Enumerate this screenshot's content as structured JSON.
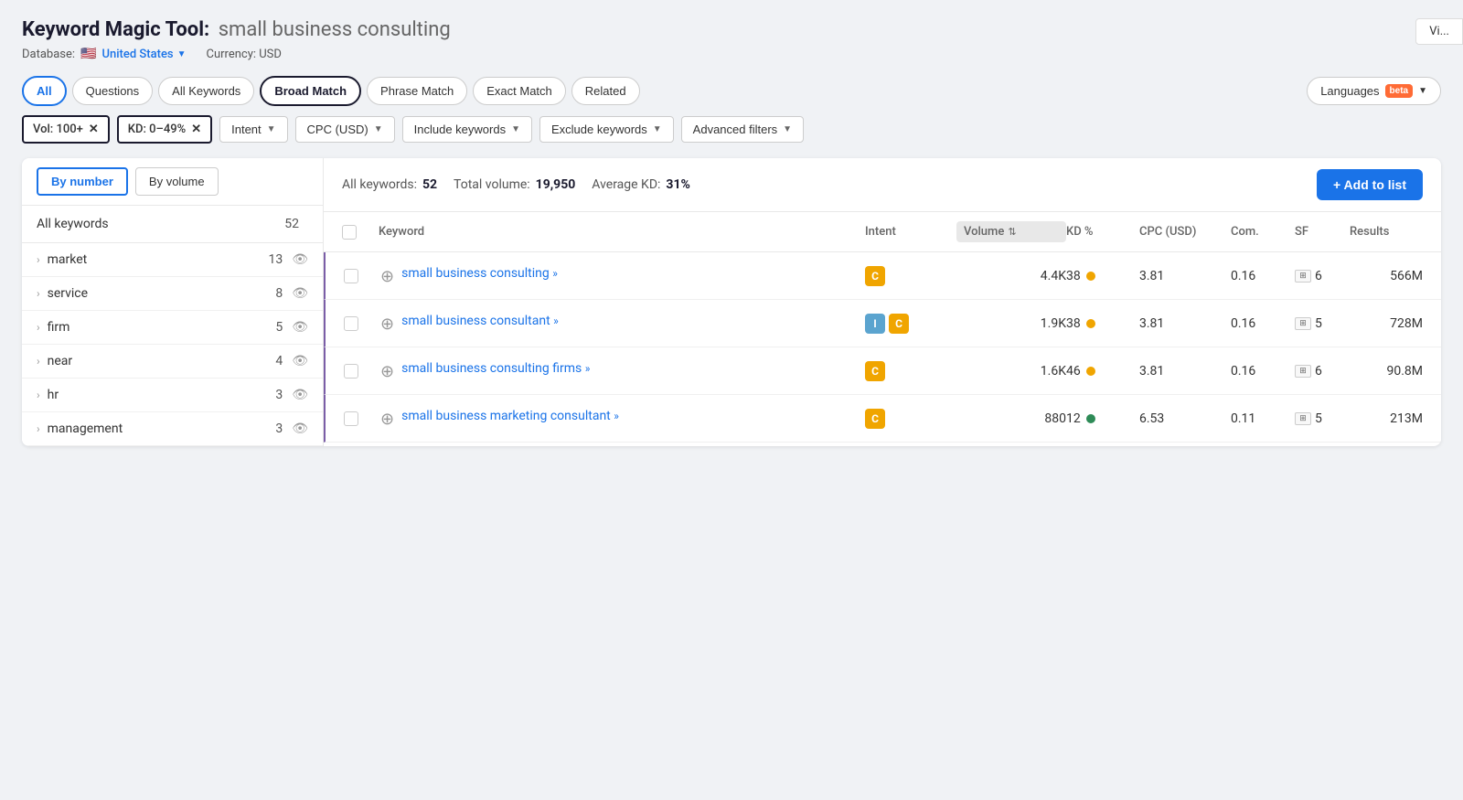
{
  "header": {
    "tool_label": "Keyword Magic Tool:",
    "query": "small business consulting",
    "db_label": "Database:",
    "db_country": "United States",
    "currency_label": "Currency: USD",
    "top_right_btn": "Vi..."
  },
  "filter_row1": {
    "tabs": [
      {
        "id": "all",
        "label": "All",
        "active": true
      },
      {
        "id": "questions",
        "label": "Questions"
      },
      {
        "id": "all-keywords",
        "label": "All Keywords"
      },
      {
        "id": "broad-match",
        "label": "Broad Match",
        "selected": true
      },
      {
        "id": "phrase-match",
        "label": "Phrase Match"
      },
      {
        "id": "exact-match",
        "label": "Exact Match"
      },
      {
        "id": "related",
        "label": "Related"
      }
    ],
    "languages_btn": "Languages",
    "beta_label": "beta"
  },
  "filter_row2": {
    "chips": [
      {
        "id": "vol",
        "label": "Vol: 100+"
      },
      {
        "id": "kd",
        "label": "KD: 0–49%"
      }
    ],
    "dropdowns": [
      {
        "id": "intent",
        "label": "Intent"
      },
      {
        "id": "cpc",
        "label": "CPC (USD)"
      },
      {
        "id": "include",
        "label": "Include keywords"
      },
      {
        "id": "exclude",
        "label": "Exclude keywords"
      },
      {
        "id": "advanced",
        "label": "Advanced filters"
      }
    ]
  },
  "stats": {
    "all_keywords_label": "All keywords:",
    "all_keywords_value": "52",
    "total_volume_label": "Total volume:",
    "total_volume_value": "19,950",
    "avg_kd_label": "Average KD:",
    "avg_kd_value": "31%",
    "add_to_list_btn": "+ Add to list"
  },
  "table": {
    "headers": [
      {
        "id": "checkbox",
        "label": ""
      },
      {
        "id": "keyword",
        "label": "Keyword"
      },
      {
        "id": "intent",
        "label": "Intent"
      },
      {
        "id": "volume",
        "label": "Volume"
      },
      {
        "id": "kd",
        "label": "KD %"
      },
      {
        "id": "cpc",
        "label": "CPC (USD)"
      },
      {
        "id": "com",
        "label": "Com."
      },
      {
        "id": "sf",
        "label": "SF"
      },
      {
        "id": "results",
        "label": "Results"
      }
    ],
    "rows": [
      {
        "keyword": "small business consulting",
        "arrows": "»",
        "intent": [
          "C"
        ],
        "volume": "4.4K",
        "kd": "38",
        "kd_color": "yellow",
        "cpc": "3.81",
        "com": "0.16",
        "sf": "6",
        "results": "566M"
      },
      {
        "keyword": "small business consultant",
        "arrows": "»",
        "intent": [
          "I",
          "C"
        ],
        "volume": "1.9K",
        "kd": "38",
        "kd_color": "yellow",
        "cpc": "3.81",
        "com": "0.16",
        "sf": "5",
        "results": "728M"
      },
      {
        "keyword": "small business consulting firms",
        "arrows": "»",
        "intent": [
          "C"
        ],
        "volume": "1.6K",
        "kd": "46",
        "kd_color": "yellow",
        "cpc": "3.81",
        "com": "0.16",
        "sf": "6",
        "results": "90.8M"
      },
      {
        "keyword": "small business marketing consultant",
        "arrows": "»",
        "intent": [
          "C"
        ],
        "volume": "880",
        "kd": "12",
        "kd_color": "green",
        "cpc": "6.53",
        "com": "0.11",
        "sf": "5",
        "results": "213M"
      }
    ]
  },
  "sidebar": {
    "all_keywords_label": "All keywords",
    "all_keywords_count": "52",
    "btn_by_number": "By number",
    "btn_by_volume": "By volume",
    "items": [
      {
        "label": "market",
        "count": "13"
      },
      {
        "label": "service",
        "count": "8"
      },
      {
        "label": "firm",
        "count": "5"
      },
      {
        "label": "near",
        "count": "4"
      },
      {
        "label": "hr",
        "count": "3"
      },
      {
        "label": "management",
        "count": "3"
      }
    ]
  }
}
